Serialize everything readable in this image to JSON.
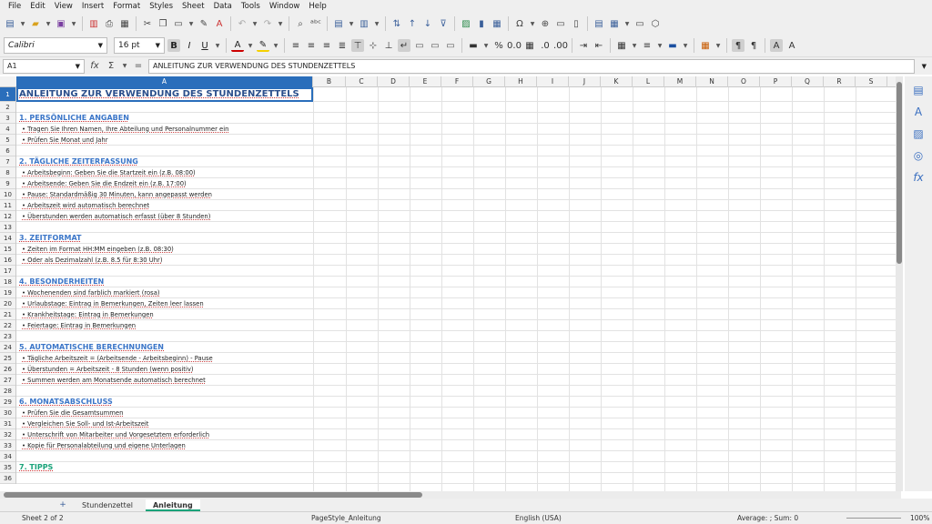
{
  "menu": [
    "File",
    "Edit",
    "View",
    "Insert",
    "Format",
    "Styles",
    "Sheet",
    "Data",
    "Tools",
    "Window",
    "Help"
  ],
  "font": {
    "name": "Calibri",
    "size": "16 pt"
  },
  "namebox": "A1",
  "formula": "ANLEITUNG ZUR VERWENDUNG DES STUNDENZETTELS",
  "columns": [
    "A",
    "B",
    "C",
    "D",
    "E",
    "F",
    "G",
    "H",
    "I",
    "J",
    "K",
    "L",
    "M",
    "N",
    "O",
    "P",
    "Q",
    "R",
    "S"
  ],
  "rows": [
    {
      "n": "1",
      "t": ""
    },
    {
      "n": "2",
      "t": ""
    },
    {
      "n": "3",
      "t": "1. PERSÖNLICHE ANGABEN",
      "k": "h"
    },
    {
      "n": "4",
      "t": "• Tragen Sie Ihren Namen, Ihre Abteilung und Personalnummer ein",
      "k": "b"
    },
    {
      "n": "5",
      "t": "• Prüfen Sie Monat und Jahr",
      "k": "b"
    },
    {
      "n": "6",
      "t": ""
    },
    {
      "n": "7",
      "t": "2. TÄGLICHE ZEITERFASSUNG",
      "k": "h"
    },
    {
      "n": "8",
      "t": "• Arbeitsbeginn: Geben Sie die Startzeit ein (z.B. 08:00)",
      "k": "b"
    },
    {
      "n": "9",
      "t": "• Arbeitsende: Geben Sie die Endzeit ein (z.B. 17:00)",
      "k": "b"
    },
    {
      "n": "10",
      "t": "• Pause: Standardmäßig 30 Minuten, kann angepasst werden",
      "k": "b"
    },
    {
      "n": "11",
      "t": "• Arbeitszeit wird automatisch berechnet",
      "k": "b"
    },
    {
      "n": "12",
      "t": "• Überstunden werden automatisch erfasst (über 8 Stunden)",
      "k": "b"
    },
    {
      "n": "13",
      "t": ""
    },
    {
      "n": "14",
      "t": "3. ZEITFORMAT",
      "k": "h"
    },
    {
      "n": "15",
      "t": "• Zeiten im Format HH:MM eingeben (z.B. 08:30)",
      "k": "b"
    },
    {
      "n": "16",
      "t": "• Oder als Dezimalzahl (z.B. 8.5 für 8:30 Uhr)",
      "k": "b"
    },
    {
      "n": "17",
      "t": ""
    },
    {
      "n": "18",
      "t": "4. BESONDERHEITEN",
      "k": "h"
    },
    {
      "n": "19",
      "t": "• Wochenenden sind farblich markiert (rosa)",
      "k": "b"
    },
    {
      "n": "20",
      "t": "• Urlaubstage: Eintrag in Bemerkungen, Zeiten leer lassen",
      "k": "b"
    },
    {
      "n": "21",
      "t": "• Krankheitstage: Eintrag in Bemerkungen",
      "k": "b"
    },
    {
      "n": "22",
      "t": "• Feiertage: Eintrag in Bemerkungen",
      "k": "b"
    },
    {
      "n": "23",
      "t": ""
    },
    {
      "n": "24",
      "t": "5. AUTOMATISCHE BERECHNUNGEN",
      "k": "h"
    },
    {
      "n": "25",
      "t": "• Tägliche Arbeitszeit = (Arbeitsende - Arbeitsbeginn) - Pause",
      "k": "b"
    },
    {
      "n": "26",
      "t": "• Überstunden = Arbeitszeit - 8 Stunden (wenn positiv)",
      "k": "b"
    },
    {
      "n": "27",
      "t": "• Summen werden am Monatsende automatisch berechnet",
      "k": "b"
    },
    {
      "n": "28",
      "t": ""
    },
    {
      "n": "29",
      "t": "6. MONATSABSCHLUSS",
      "k": "h"
    },
    {
      "n": "30",
      "t": "• Prüfen Sie die Gesamtsummen",
      "k": "b"
    },
    {
      "n": "31",
      "t": "• Vergleichen Sie Soll- und Ist-Arbeitszeit",
      "k": "b"
    },
    {
      "n": "32",
      "t": "• Unterschrift von Mitarbeiter und Vorgesetztem erforderlich",
      "k": "b"
    },
    {
      "n": "33",
      "t": "• Kopie für Personalabteilung und eigene Unterlagen",
      "k": "b"
    },
    {
      "n": "34",
      "t": ""
    },
    {
      "n": "35",
      "t": "7. TIPPS",
      "k": "hg"
    },
    {
      "n": "36",
      "t": ""
    }
  ],
  "tabs": [
    "Stundenzettel",
    "Anleitung"
  ],
  "status": {
    "sheet": "Sheet 2 of 2",
    "style": "PageStyle_Anleitung",
    "lang": "English (USA)",
    "calc": "Average: ; Sum: 0",
    "zoom": "100%"
  }
}
